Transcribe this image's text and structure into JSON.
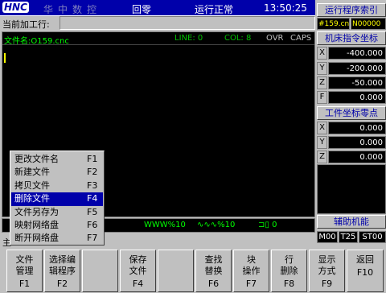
{
  "topbar": {
    "logo": "HNC",
    "company": "华中数控",
    "mode": "回零",
    "run_state": "运行正常",
    "clock": "13:50:25"
  },
  "current_line": {
    "label": "当前加工行:"
  },
  "file_bar": {
    "file_label": "文件名:O159.cnc",
    "line_label": "LINE: 0",
    "col_label": "COL: 8",
    "ovr": "OVR",
    "caps": "CAPS"
  },
  "strip": {
    "spindle": "%10",
    "feed": "%10",
    "rapid": "0"
  },
  "menu": {
    "items": [
      {
        "label": "更改文件名",
        "shortcut": "F1"
      },
      {
        "label": "新建文件",
        "shortcut": "F2"
      },
      {
        "label": "拷贝文件",
        "shortcut": "F3"
      },
      {
        "label": "删除文件",
        "shortcut": "F4",
        "selected": true
      },
      {
        "label": "文件另存为",
        "shortcut": "F5"
      },
      {
        "label": "映射网络盘",
        "shortcut": "F6"
      },
      {
        "label": "断开网络盘",
        "shortcut": "F7"
      }
    ]
  },
  "main_peek": "主",
  "right_panel": {
    "program_index_title": "运行程序索引",
    "program_file": "#159.cn",
    "program_n": "N00000",
    "machine_coord_title": "机床指令坐标",
    "machine": [
      {
        "axis": "X",
        "value": "-400.000"
      },
      {
        "axis": "Y",
        "value": "-200.000"
      },
      {
        "axis": "Z",
        "value": "-50.000"
      },
      {
        "axis": "F",
        "value": "0.000"
      }
    ],
    "work_zero_title": "工件坐标零点",
    "work": [
      {
        "axis": "X",
        "value": "0.000"
      },
      {
        "axis": "Y",
        "value": "0.000"
      },
      {
        "axis": "Z",
        "value": "0.000"
      }
    ],
    "aux_title": "辅助机能",
    "mst": [
      "M00",
      "T25",
      "ST00"
    ]
  },
  "fkeys": [
    {
      "line1": "文件",
      "line2": "管理",
      "num": "F1"
    },
    {
      "line1": "选择编",
      "line2": "辑程序",
      "num": "F2"
    },
    {
      "line1": "",
      "line2": "",
      "num": ""
    },
    {
      "line1": "保存",
      "line2": "文件",
      "num": "F4"
    },
    {
      "line1": "",
      "line2": "",
      "num": ""
    },
    {
      "line1": "查找",
      "line2": "替换",
      "num": "F6"
    },
    {
      "line1": "块",
      "line2": "操作",
      "num": "F7"
    },
    {
      "line1": "行",
      "line2": "删除",
      "num": "F8"
    },
    {
      "line1": "显示",
      "line2": "方式",
      "num": "F9"
    },
    {
      "line1": "返回",
      "line2": "",
      "num": "F10"
    }
  ],
  "colors": {
    "title_bar": "#0000aa",
    "panel": "#c0c0c0",
    "editor_bg": "#000000",
    "highlight": "#0000aa",
    "file_text": "#00ff00",
    "cursor": "#ffff00"
  }
}
